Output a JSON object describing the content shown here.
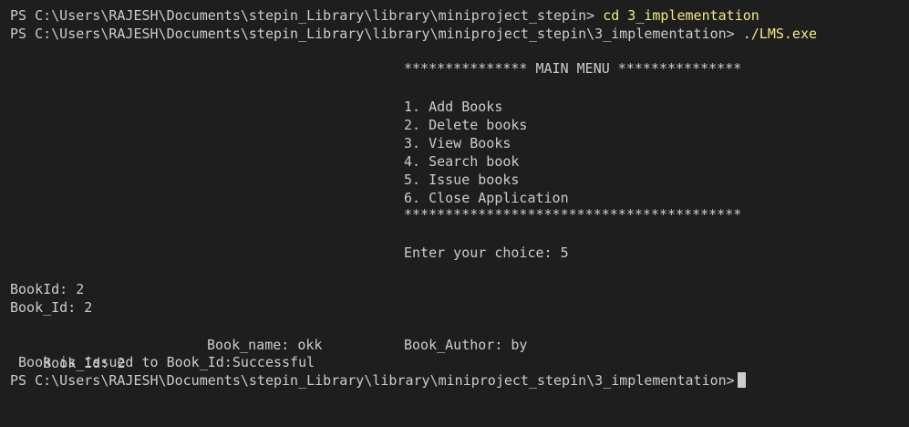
{
  "terminal": {
    "prompt_path_1": "PS C:\\Users\\RAJESH\\Documents\\stepin_Library\\library\\miniproject_stepin>",
    "command_1": "cd 3_implementation",
    "prompt_path_2": "PS C:\\Users\\RAJESH\\Documents\\stepin_Library\\library\\miniproject_stepin\\3_implementation>",
    "command_2": "./LMS.exe",
    "menu_header": "*************** MAIN MENU ***************",
    "menu_items": [
      "1. Add Books",
      "2. Delete books",
      "3. View Books",
      "4. Search book",
      "5. Issue books",
      "6. Close Application"
    ],
    "menu_footer": "*****************************************",
    "choice_prompt": "Enter your choice: 5",
    "bookid_line": "BookId: 2",
    "book_id_line": "Book_Id: 2",
    "result_book_id": "Book_Id: 2",
    "result_book_name": "Book_name: okk",
    "result_book_author": "Book_Author: by",
    "issue_message": " Book is issued to Book_Id:Successful",
    "prompt_path_3": "PS C:\\Users\\RAJESH\\Documents\\stepin_Library\\library\\miniproject_stepin\\3_implementation>",
    "colors": {
      "background": "#1e1e1e",
      "text": "#cccccc",
      "command": "#f1ea87"
    }
  }
}
